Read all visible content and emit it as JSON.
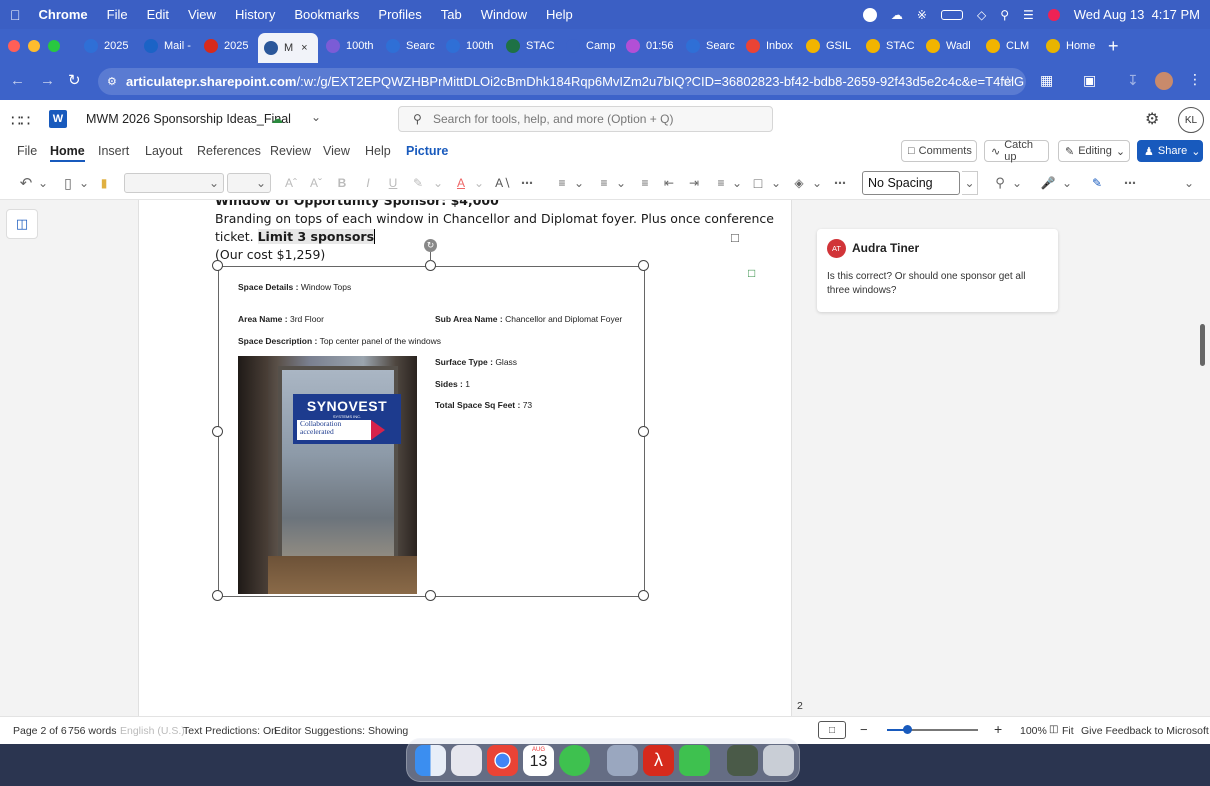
{
  "menubar": {
    "app": "Chrome",
    "items": [
      "File",
      "Edit",
      "View",
      "History",
      "Bookmarks",
      "Profiles",
      "Tab",
      "Window",
      "Help"
    ],
    "datetime": "Wed Aug 13  4:17 PM"
  },
  "tabs": [
    {
      "label": "2025",
      "icon": "c-icon",
      "color": "#2f6fd6"
    },
    {
      "label": "Mail -",
      "icon": "outlook-icon",
      "color": "#1b63c6"
    },
    {
      "label": "2025",
      "icon": "pdf-icon",
      "color": "#d62a1c"
    },
    {
      "label": "M",
      "icon": "word-icon",
      "color": "#2b579a",
      "active": true
    },
    {
      "label": "100th",
      "icon": "c-icon",
      "color": "#7b5cd6"
    },
    {
      "label": "Searc",
      "icon": "c-icon",
      "color": "#2f6fd6"
    },
    {
      "label": "100th",
      "icon": "c-icon",
      "color": "#2f6fd6"
    },
    {
      "label": "STAC",
      "icon": "excel-icon",
      "color": "#1e7145"
    },
    {
      "label": "Camp",
      "icon": "blank-icon",
      "color": "#3d63c9"
    },
    {
      "label": "01:56",
      "icon": "timer-icon",
      "color": "#b24fd6"
    },
    {
      "label": "Searc",
      "icon": "c-icon",
      "color": "#2f6fd6"
    },
    {
      "label": "Inbox",
      "icon": "gmail-icon",
      "color": "#ea4335"
    },
    {
      "label": "GSIL",
      "icon": "folder-icon",
      "color": "#f2b400"
    },
    {
      "label": "STAC",
      "icon": "folder-icon",
      "color": "#f2b400"
    },
    {
      "label": "Wadl",
      "icon": "folder-icon",
      "color": "#f2b400"
    },
    {
      "label": "CLM",
      "icon": "folder-icon",
      "color": "#f2b400"
    },
    {
      "label": "Home",
      "icon": "c-icon",
      "color": "#e8b400"
    }
  ],
  "address": {
    "domain": "articulatepr.sharepoint.com",
    "path": "/:w:/g/EXT2EPQWZHBPrMittDLOi2cBmDhk184Rqp6MvIZm2u7bIQ?CID=36802823-bf42-bdb8-2659-92f43d5e2c4c&e=T4felG"
  },
  "word": {
    "doc_title": "MWM 2026 Sponsorship Ideas_Final",
    "search_placeholder": "Search for tools, help, and more (Option + Q)",
    "user_initials": "KL",
    "ribbon_tabs": [
      "File",
      "Home",
      "Insert",
      "Layout",
      "References",
      "Review",
      "View",
      "Help",
      "Picture"
    ],
    "active_tab": "Home",
    "comments_label": "Comments",
    "catchup_label": "Catch up",
    "editing_label": "Editing",
    "share_label": "Share",
    "style_value": "No Spacing",
    "accent": "#185abd"
  },
  "document": {
    "heading_partial": "Window of Opportunity Sponsor: $4,000",
    "line1": "Branding on tops of each window in Chancellor and Diplomat foyer. Plus once conference",
    "line2_prefix": "ticket. ",
    "line2_bold": "Limit 3 sponsors",
    "line3": "(Our cost $1,259)",
    "image_fields": {
      "space_details_label": "Space Details :",
      "space_details_value": " Window Tops",
      "area_name_label": "Area Name :",
      "area_name_value": " 3rd Floor",
      "sub_area_label": "Sub Area Name :",
      "sub_area_value": " Chancellor and Diplomat Foyer",
      "space_desc_label": "Space Description :",
      "space_desc_value": " Top center panel of the windows",
      "surface_label": "Surface Type :",
      "surface_value": " Glass",
      "sides_label": "Sides :",
      "sides_value": " 1",
      "sqft_label": "Total Space Sq Feet :",
      "sqft_value": " 73"
    },
    "sign_brand": "SYNOVEST",
    "sign_sub": "SYSTEMS INC.",
    "sign_tag1": "Collaboration",
    "sign_tag2": "accelerated",
    "page_number": "2"
  },
  "comment": {
    "initials": "AT",
    "author": "Audra Tiner",
    "text": "Is this correct? Or should one sponsor get all three windows?"
  },
  "status": {
    "page": "Page 2 of 6",
    "words": "756 words",
    "language": "English (U.S.)",
    "predictions": "Text Predictions: On",
    "editor": "Editor Suggestions: Showing",
    "zoom": "100%",
    "fit": "Fit",
    "feedback": "Give Feedback to Microsoft"
  },
  "dock": {
    "calendar_month": "AUG",
    "calendar_day": "13"
  }
}
